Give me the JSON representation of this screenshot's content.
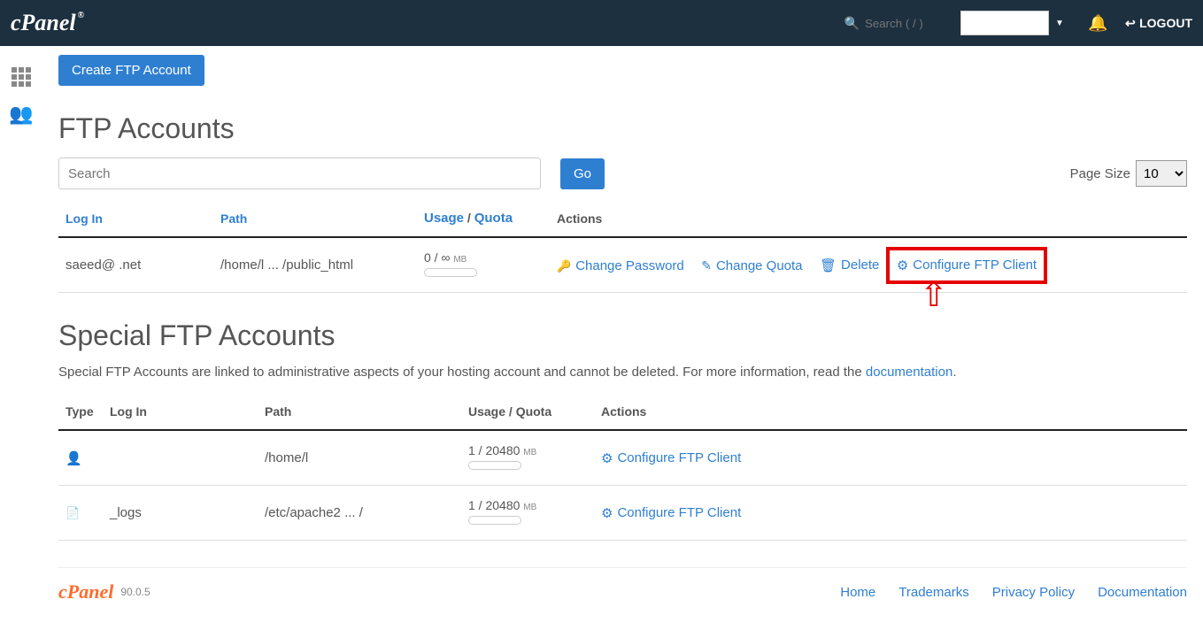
{
  "header": {
    "search_placeholder": "Search ( / )",
    "logout_label": "LOGOUT"
  },
  "sidebar": {},
  "create_button": "Create FTP Account",
  "accounts": {
    "title": "FTP Accounts",
    "search_placeholder": "Search",
    "go_label": "Go",
    "page_size_label": "Page Size",
    "page_size_value": "10",
    "columns": {
      "login": "Log In",
      "path": "Path",
      "usage": "Usage",
      "quota": "Quota",
      "actions": "Actions"
    },
    "rows": [
      {
        "login": "saeed@             .net",
        "path": "/home/l      ...  /public_html",
        "usage": "0 / ∞",
        "usage_unit": "MB",
        "change_password": "Change Password",
        "change_quota": "Change Quota",
        "delete": "Delete",
        "configure": "Configure FTP Client"
      }
    ]
  },
  "special": {
    "title": "Special FTP Accounts",
    "desc_a": "Special FTP Accounts are linked to administrative aspects of your hosting account and cannot be deleted. For more information, read the ",
    "desc_link": "documentation",
    "desc_b": ".",
    "columns": {
      "type": "Type",
      "login": "Log In",
      "path": "Path",
      "usage": "Usage / Quota",
      "actions": "Actions"
    },
    "rows": [
      {
        "icon": "person",
        "login": "",
        "path": "/home/l",
        "usage": "1 / 20480",
        "usage_unit": "MB",
        "configure": "Configure FTP Client"
      },
      {
        "icon": "file",
        "login": "              _logs",
        "path": "/etc/apache2 ... /",
        "usage": "1 / 20480",
        "usage_unit": "MB",
        "configure": "Configure FTP Client"
      }
    ]
  },
  "footer": {
    "version": "90.0.5",
    "links": {
      "home": "Home",
      "trademarks": "Trademarks",
      "privacy": "Privacy Policy",
      "documentation": "Documentation"
    }
  }
}
